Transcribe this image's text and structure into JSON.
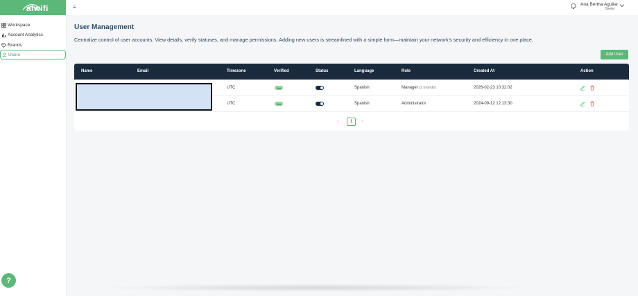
{
  "app": {
    "logo_text": "aiwifi",
    "accent": "#5cb879",
    "header_dark": "#1a2b3d"
  },
  "sidebar": {
    "items": [
      {
        "label": "Workspace",
        "icon": "grid-icon"
      },
      {
        "label": "Account Analytics",
        "icon": "chart-icon"
      },
      {
        "label": "Brands",
        "icon": "tag-icon"
      },
      {
        "label": "Users",
        "icon": "user-icon",
        "active": true
      }
    ],
    "help_label": "?"
  },
  "topbar": {
    "menu_icon": "≡",
    "user_name": "Ana Bertha Aguilar",
    "user_role": "Owner"
  },
  "page": {
    "title": "User Management",
    "description": "Centralize control of user accounts. View details, verify statuses, and manage permissions. Adding new users is streamlined with a simple form—maintain your network's security and efficiency in one place.",
    "add_button": "Add User"
  },
  "table": {
    "headers": {
      "name": "Name",
      "email": "Email",
      "timezone": "Timezone",
      "verified": "Verified",
      "status": "Status",
      "language": "Language",
      "role": "Role",
      "created": "Created At",
      "action": "Action"
    },
    "rows": [
      {
        "timezone": "UTC",
        "verified": "Yes",
        "status_on": true,
        "language": "Spanish",
        "role": "Manager",
        "role_extra": "(2 brands)",
        "created": "2026-02-23 10:32:02"
      },
      {
        "timezone": "UTC",
        "verified": "Yes",
        "status_on": true,
        "language": "Spanish",
        "role": "Administrator",
        "role_extra": "",
        "created": "2024-09-12 12:13:30"
      }
    ]
  },
  "pagination": {
    "prev": "‹",
    "current": "1",
    "next": "›"
  }
}
